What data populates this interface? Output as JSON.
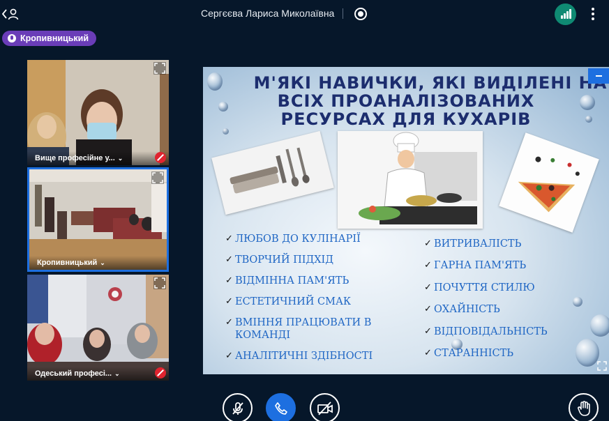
{
  "header": {
    "presenter_name": "Сергєєва Лариса Миколаївна",
    "room_badge": "Кропивницький"
  },
  "tiles": [
    {
      "label": "Вище професійне у...",
      "muted": true
    },
    {
      "label": "Кропивницький",
      "muted": false,
      "active": true
    },
    {
      "label": "Одеський професі...",
      "muted": true
    }
  ],
  "slide": {
    "title_line1": "М'ЯКІ НАВИЧКИ, ЯКІ ВИДІЛЕНІ НА",
    "title_line2": "ВСІХ ПРОАНАЛІЗОВАНИХ",
    "title_line3": "РЕСУРСАХ ДЛЯ КУХАРІВ",
    "skills_left": [
      "ЛЮБОВ ДО КУЛІНАРІЇ",
      "ТВОРЧИЙ ПІДХІД",
      "ВІДМІННА ПАМ'ЯТЬ",
      "ЕСТЕТИЧНИЙ СМАК",
      "ВМІННЯ ПРАЦЮВАТИ В КОМАНДІ",
      "АНАЛІТИЧНІ ЗДІБНОСТІ"
    ],
    "skills_right": [
      "ВИТРИВАЛІСТЬ",
      "ГАРНА ПАМ'ЯТЬ",
      "ПОЧУТТЯ СТИЛЮ",
      "ОХАЙНІСТЬ",
      "ВІДПОВІДАЛЬНІСТЬ",
      "СТАРАННІСТЬ"
    ]
  },
  "icons": {
    "back": "chevron-left-user-icon",
    "record": "record-icon",
    "connection": "signal-bars-icon",
    "more": "vertical-dots-icon",
    "mic_off": "mic-off-icon",
    "call": "phone-icon",
    "cam_off": "camera-off-icon",
    "raise_hand": "hand-icon"
  },
  "colors": {
    "background": "#06172a",
    "accent": "#1d6fe0",
    "room_badge": "#6a3db8",
    "connection": "#0f8a73",
    "muted": "#e0242f",
    "slide_title": "#1c2d6e",
    "slide_skill": "#1f66c4"
  }
}
